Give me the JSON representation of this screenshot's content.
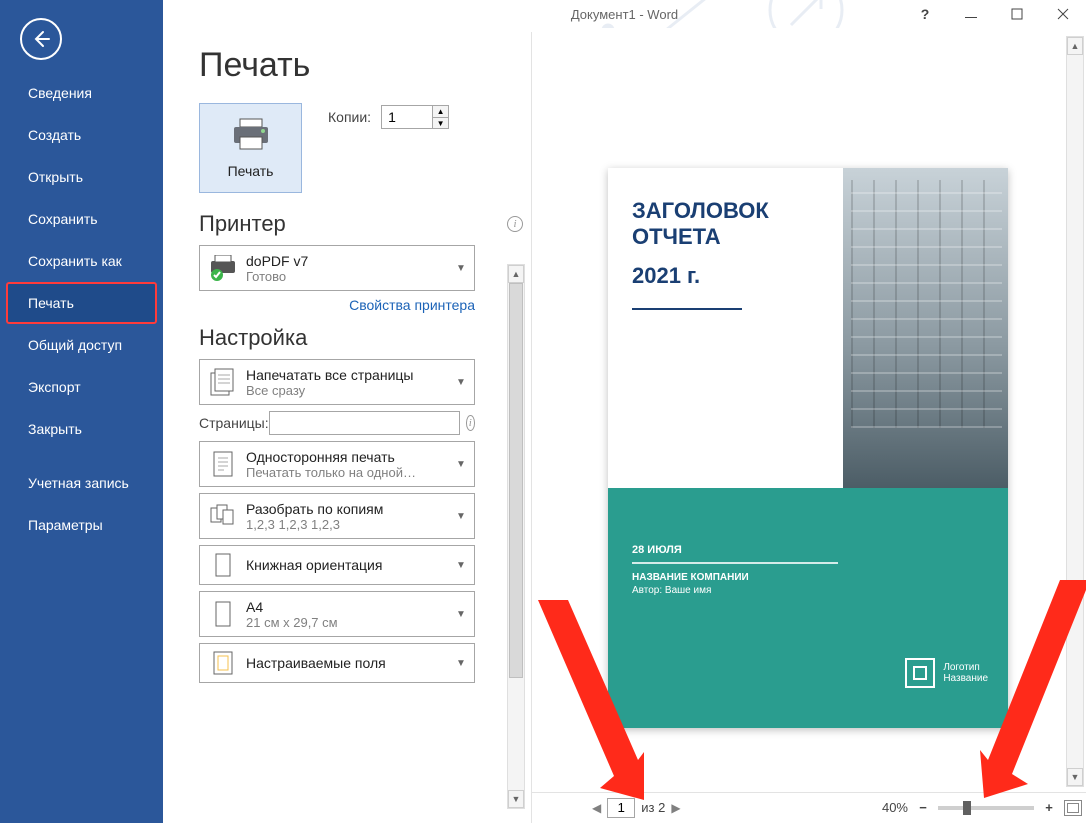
{
  "titlebar": {
    "title": "Документ1 - Word"
  },
  "sidebar": {
    "items": [
      "Сведения",
      "Создать",
      "Открыть",
      "Сохранить",
      "Сохранить как",
      "Печать",
      "Общий доступ",
      "Экспорт",
      "Закрыть"
    ],
    "footerItems": [
      "Учетная запись",
      "Параметры"
    ],
    "selectedIndex": 5
  },
  "page": {
    "heading": "Печать",
    "printButton": "Печать",
    "copiesLabel": "Копии:",
    "copiesValue": "1",
    "printerSection": "Принтер",
    "printer": {
      "name": "doPDF v7",
      "status": "Готово"
    },
    "printerPropsLink": "Свойства принтера",
    "settingsSection": "Настройка",
    "options": {
      "range": {
        "primary": "Напечатать все страницы",
        "secondary": "Все сразу"
      },
      "pagesLabel": "Страницы:",
      "pagesValue": "",
      "sides": {
        "primary": "Односторонняя печать",
        "secondary": "Печатать только на одной…"
      },
      "collate": {
        "primary": "Разобрать по копиям",
        "secondary": "1,2,3    1,2,3    1,2,3"
      },
      "orient": {
        "primary": "Книжная ориентация",
        "secondary": ""
      },
      "paper": {
        "primary": "A4",
        "secondary": "21 см x 29,7 см"
      },
      "margins": {
        "primary": "Настраиваемые поля",
        "secondary": ""
      }
    }
  },
  "preview": {
    "title1": "ЗАГОЛОВОК",
    "title2": "ОТЧЕТА",
    "year": "2021 г.",
    "date": "28 ИЮЛЯ",
    "company": "НАЗВАНИЕ КОМПАНИИ",
    "author": "Автор: Ваше имя",
    "logoText1": "Логотип",
    "logoText2": "Название"
  },
  "statusbar": {
    "page": "1",
    "of": "из 2",
    "zoom": "40%"
  }
}
